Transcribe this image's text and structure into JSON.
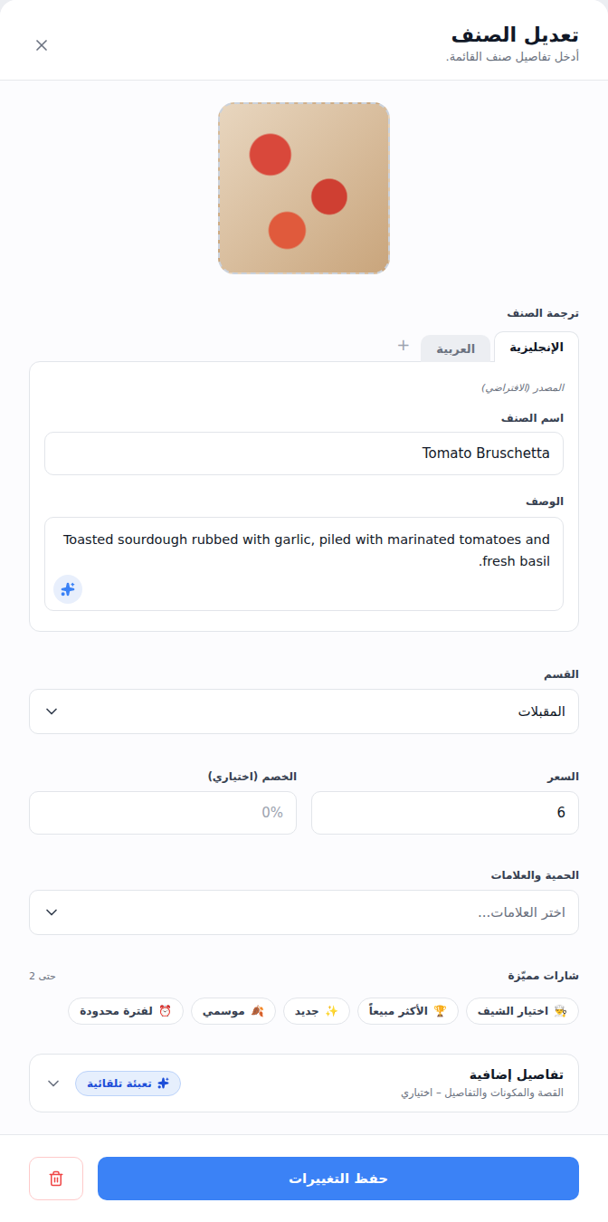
{
  "header": {
    "title": "تعديل الصنف",
    "subtitle": "أدخل تفاصيل صنف القائمة."
  },
  "translation": {
    "label": "ترجمة الصنف",
    "tabs": [
      {
        "label": "الإنجليزية",
        "selected": true
      },
      {
        "label": "العربية",
        "selected": false
      }
    ],
    "add_tab": "+",
    "source_note": "المصدر (الافتراضي)",
    "name_label": "اسم الصنف",
    "name_value": "Tomato Bruschetta",
    "description_label": "الوصف",
    "description_value": "Toasted sourdough rubbed with garlic, piled with marinated tomatoes and fresh basil."
  },
  "category": {
    "label": "القسم",
    "value": "المقبلات"
  },
  "price": {
    "label": "السعر",
    "value": "6"
  },
  "discount": {
    "label": "الخصم (اختياري)",
    "placeholder": "0%"
  },
  "tags": {
    "label": "الحمية والعلامات",
    "placeholder": "اختر العلامات..."
  },
  "badges": {
    "label": "شارات مميّزة",
    "limit": "حتى 2",
    "items": [
      {
        "icon": "👨‍🍳",
        "label": "اختيار الشيف",
        "selected": false
      },
      {
        "icon": "🏆",
        "label": "الأكثر مبيعاً",
        "selected": false
      },
      {
        "icon": "✨",
        "label": "جديد",
        "selected": false
      },
      {
        "icon": "🍂",
        "label": "موسمي",
        "selected": false
      },
      {
        "icon": "⏰",
        "label": "لفترة محدودة",
        "selected": false
      }
    ]
  },
  "extra": {
    "title": "تفاصيل إضافية",
    "subtitle": "القصة والمكونات والتفاصيل – اختياري",
    "autofill": "تعبئة تلقائية",
    "expanded": false
  },
  "footer": {
    "save": "حفظ التغييرات"
  }
}
